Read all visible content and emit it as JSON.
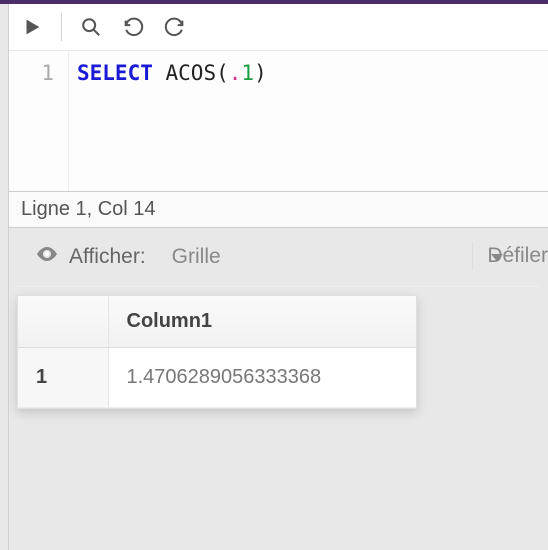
{
  "editor": {
    "line_number": "1",
    "sql": {
      "keyword": "SELECT",
      "func": "ACOS",
      "open": "(",
      "dot": ".",
      "num": "1",
      "close": ")"
    }
  },
  "status": {
    "text": "Ligne 1, Col 14"
  },
  "view": {
    "label": "Afficher:",
    "selected": "Grille",
    "scroll_label": "Défiler"
  },
  "table": {
    "columns": [
      "Column1"
    ],
    "rows": [
      {
        "index": "1",
        "cells": [
          "1.4706289056333368"
        ]
      }
    ]
  }
}
